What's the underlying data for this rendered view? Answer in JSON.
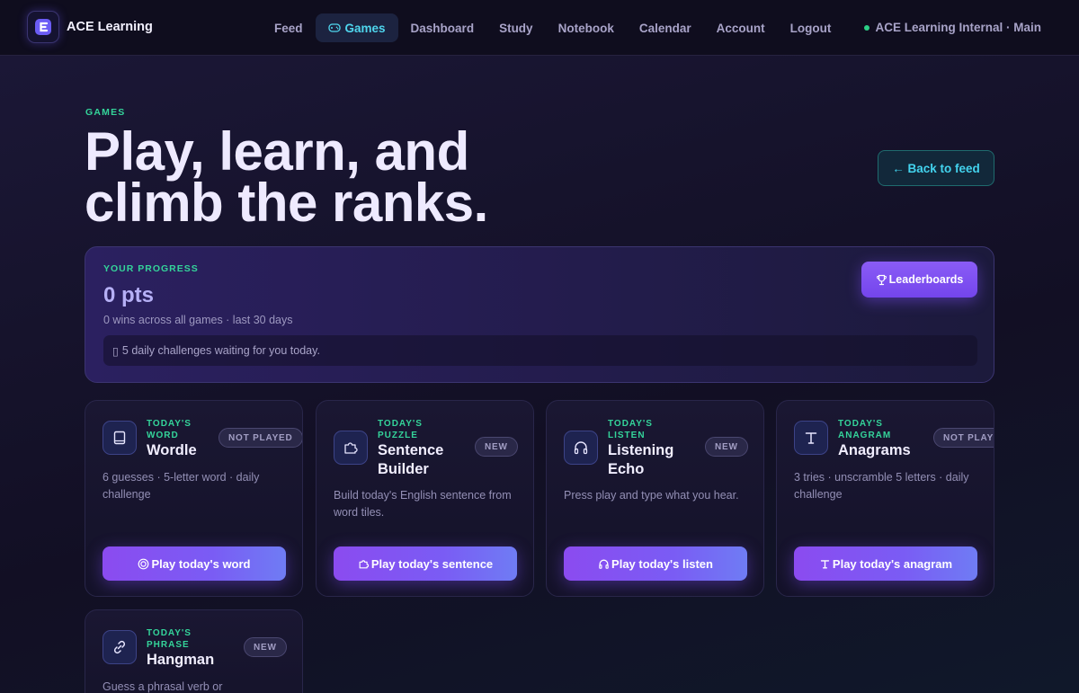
{
  "brand": {
    "name": "ACE Learning"
  },
  "nav": {
    "items": [
      {
        "label": "Feed",
        "active": false
      },
      {
        "label": "Games",
        "active": true
      },
      {
        "label": "Dashboard",
        "active": false
      },
      {
        "label": "Study",
        "active": false
      },
      {
        "label": "Notebook",
        "active": false
      },
      {
        "label": "Calendar",
        "active": false
      },
      {
        "label": "Account",
        "active": false
      },
      {
        "label": "Logout",
        "active": false
      }
    ],
    "workspace": "ACE Learning Internal · Main"
  },
  "hero": {
    "eyebrow": "GAMES",
    "title_line1": "Play, learn, and",
    "title_line2": "climb the ranks.",
    "back_button": "← Back to feed"
  },
  "progress": {
    "label": "YOUR PROGRESS",
    "points": "0 pts",
    "summary": "0 wins across all games · last 30 days",
    "notice_glyph": "▯",
    "notice": "5 daily challenges waiting for you today.",
    "leaderboards_button": "Leaderboards"
  },
  "games": [
    {
      "tag": "Today's Word",
      "name": "Wordle",
      "badge": "NOT PLAYED",
      "description": "6 guesses · 5-letter word · daily challenge",
      "button": "Play today's word",
      "icon": "book-icon"
    },
    {
      "tag": "Today's Puzzle",
      "name": "Sentence Builder",
      "badge": "NEW",
      "description": "Build today's English sentence from word tiles.",
      "button": "Play today's sentence",
      "icon": "puzzle-icon"
    },
    {
      "tag": "Today's Listen",
      "name": "Listening Echo",
      "badge": "NEW",
      "description": "Press play and type what you hear.",
      "button": "Play today's listen",
      "icon": "headphones-icon"
    },
    {
      "tag": "Today's Anagram",
      "name": "Anagrams",
      "badge": "NOT PLAYED",
      "description": "3 tries · unscramble 5 letters · daily challenge",
      "button": "Play today's anagram",
      "icon": "type-icon"
    },
    {
      "tag": "Today's Phrase",
      "name": "Hangman",
      "badge": "NEW",
      "description": "Guess a phrasal verb or",
      "button": "",
      "icon": "link-icon"
    }
  ],
  "colors": {
    "accent_green": "#34d49a",
    "accent_cyan": "#43d3ee",
    "accent_purple": "#8b4bf0",
    "background": "#16132c"
  }
}
